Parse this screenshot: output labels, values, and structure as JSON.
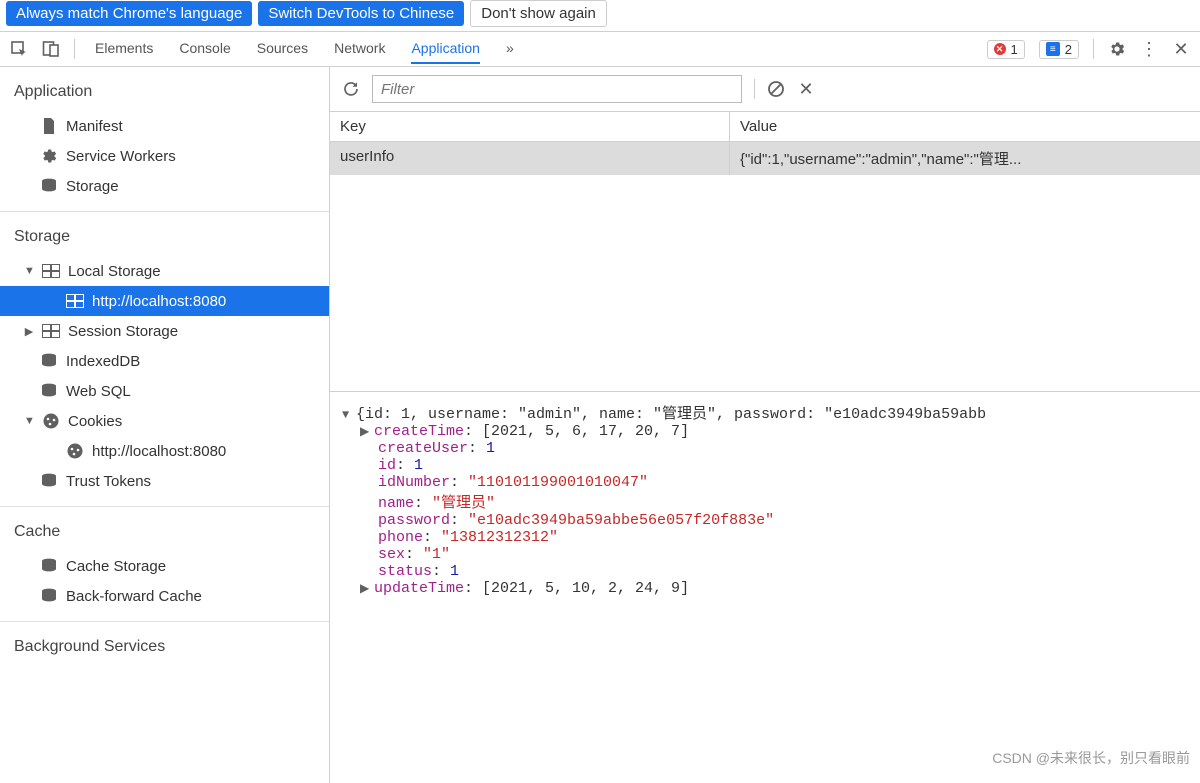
{
  "banner": {
    "match": "Always match Chrome's language",
    "switch": "Switch DevTools to Chinese",
    "dont": "Don't show again"
  },
  "tabs": [
    "Elements",
    "Console",
    "Sources",
    "Network",
    "Application"
  ],
  "activeTab": "Application",
  "badges": {
    "errors": "1",
    "info": "2"
  },
  "sidebar": {
    "application": {
      "heading": "Application",
      "items": [
        "Manifest",
        "Service Workers",
        "Storage"
      ]
    },
    "storage": {
      "heading": "Storage",
      "local": "Local Storage",
      "localChild": "http://localhost:8080",
      "session": "Session Storage",
      "indexeddb": "IndexedDB",
      "websql": "Web SQL",
      "cookies": "Cookies",
      "cookiesChild": "http://localhost:8080",
      "trust": "Trust Tokens"
    },
    "cache": {
      "heading": "Cache",
      "items": [
        "Cache Storage",
        "Back-forward Cache"
      ]
    },
    "bg": {
      "heading": "Background Services"
    }
  },
  "filter": {
    "placeholder": "Filter"
  },
  "table": {
    "headKey": "Key",
    "headVal": "Value",
    "rowKey": "userInfo",
    "rowVal": "{\"id\":1,\"username\":\"admin\",\"name\":\"管理..."
  },
  "detail": {
    "topline": "{id: 1, username: \"admin\", name: \"管理员\", password: \"e10adc3949ba59abb",
    "createTime_k": "createTime",
    "createTime_v": "[2021, 5, 6, 17, 20, 7]",
    "createUser_k": "createUser",
    "createUser_v": "1",
    "id_k": "id",
    "id_v": "1",
    "idNumber_k": "idNumber",
    "idNumber_v": "\"110101199001010047\"",
    "name_k": "name",
    "name_v": "\"管理员\"",
    "password_k": "password",
    "password_v": "\"e10adc3949ba59abbe56e057f20f883e\"",
    "phone_k": "phone",
    "phone_v": "\"13812312312\"",
    "sex_k": "sex",
    "sex_v": "\"1\"",
    "status_k": "status",
    "status_v": "1",
    "updateTime_k": "updateTime",
    "updateTime_v": "[2021, 5, 10, 2, 24, 9]"
  },
  "watermark": "CSDN @未来很长，别只看眼前"
}
